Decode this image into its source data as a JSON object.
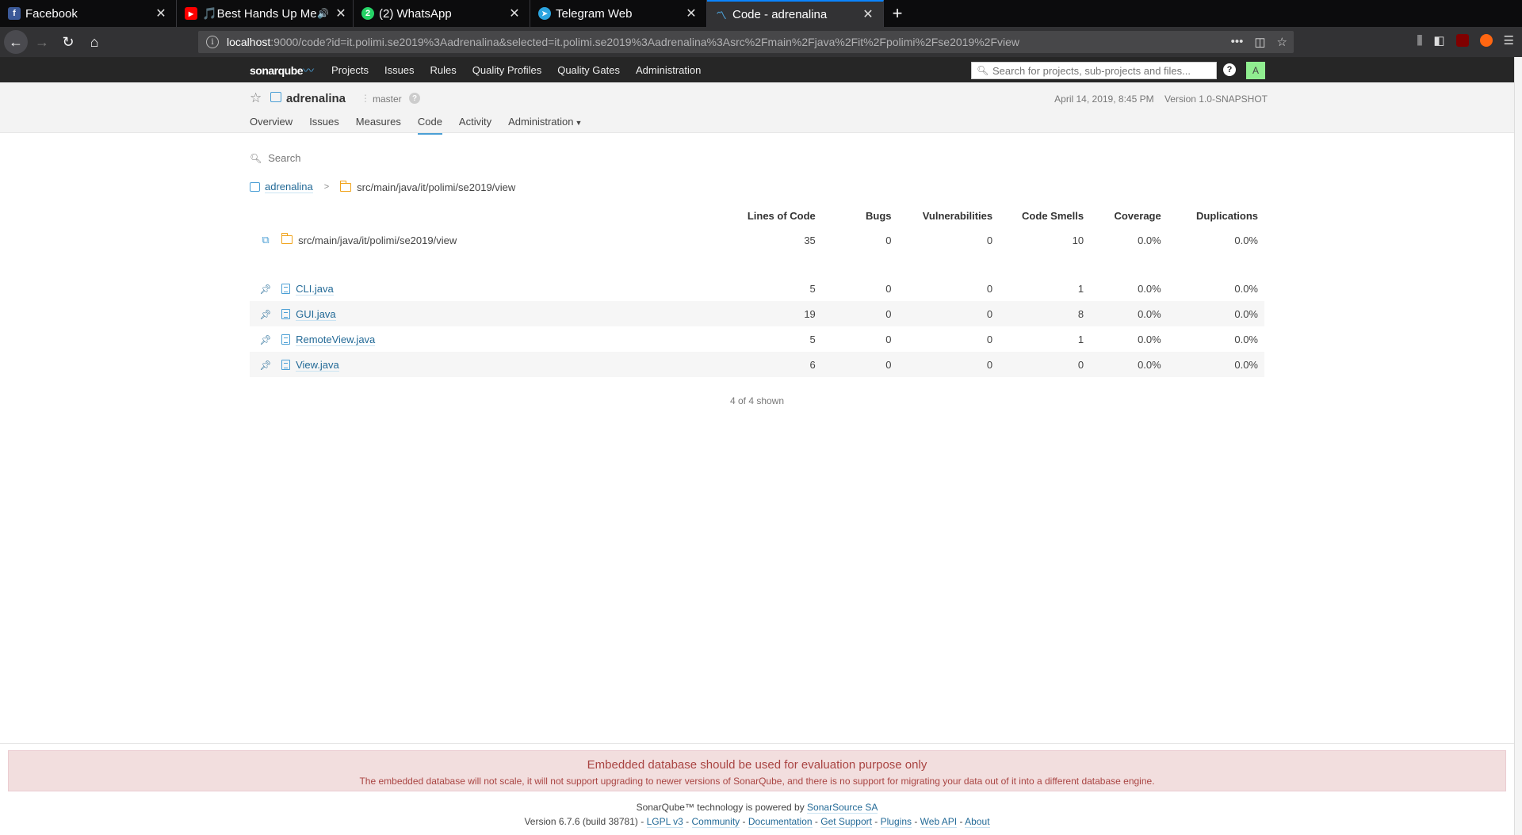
{
  "browser": {
    "tabs": [
      {
        "label": "Facebook",
        "favicon_color": "#3b5998",
        "favicon_glyph": "f"
      },
      {
        "label": "🎵Best Hands Up Meg",
        "favicon_color": "#ff0000",
        "favicon_glyph": "▶",
        "audio": "🔊"
      },
      {
        "label": "(2) WhatsApp",
        "favicon_color": "#25d366",
        "favicon_glyph": "2"
      },
      {
        "label": "Telegram Web",
        "favicon_color": "#2ca5e0",
        "favicon_glyph": "➤"
      },
      {
        "label": "Code - adrenalina",
        "favicon_color": "#4b9fd5",
        "favicon_glyph": "〽"
      }
    ],
    "url_host": "localhost",
    "url_rest": ":9000/code?id=it.polimi.se2019%3Aadrenalina&selected=it.polimi.se2019%3Aadrenalina%3Asrc%2Fmain%2Fjava%2Fit%2Fpolimi%2Fse2019%2Fview"
  },
  "sonar_nav": {
    "logo_text": "sonarqube",
    "links": [
      "Projects",
      "Issues",
      "Rules",
      "Quality Profiles",
      "Quality Gates",
      "Administration"
    ],
    "search_placeholder": "Search for projects, sub-projects and files...",
    "help_label": "?",
    "avatar_letter": "A"
  },
  "project": {
    "name": "adrenalina",
    "branch": "master",
    "analysis_date": "April 14, 2019, 8:45 PM",
    "version": "Version 1.0-SNAPSHOT",
    "tabs": [
      "Overview",
      "Issues",
      "Measures",
      "Code",
      "Activity",
      "Administration"
    ],
    "active_tab": "Code"
  },
  "code": {
    "search_placeholder": "Search",
    "breadcrumb": {
      "project": "adrenalina",
      "separator": ">",
      "folder": "src/main/java/it/polimi/se2019/view"
    },
    "columns": [
      "Lines of Code",
      "Bugs",
      "Vulnerabilities",
      "Code Smells",
      "Coverage",
      "Duplications"
    ],
    "base_row": {
      "name": "src/main/java/it/polimi/se2019/view",
      "loc": "35",
      "bugs": "0",
      "vulnerabilities": "0",
      "code_smells": "10",
      "coverage": "0.0%",
      "duplications": "0.0%"
    },
    "files": [
      {
        "name": "CLI.java",
        "loc": "5",
        "bugs": "0",
        "vulnerabilities": "0",
        "code_smells": "1",
        "coverage": "0.0%",
        "duplications": "0.0%"
      },
      {
        "name": "GUI.java",
        "loc": "19",
        "bugs": "0",
        "vulnerabilities": "0",
        "code_smells": "8",
        "coverage": "0.0%",
        "duplications": "0.0%"
      },
      {
        "name": "RemoteView.java",
        "loc": "5",
        "bugs": "0",
        "vulnerabilities": "0",
        "code_smells": "1",
        "coverage": "0.0%",
        "duplications": "0.0%"
      },
      {
        "name": "View.java",
        "loc": "6",
        "bugs": "0",
        "vulnerabilities": "0",
        "code_smells": "0",
        "coverage": "0.0%",
        "duplications": "0.0%"
      }
    ],
    "shown_text": "4 of 4 shown"
  },
  "alert": {
    "title": "Embedded database should be used for evaluation purpose only",
    "body": "The embedded database will not scale, it will not support upgrading to newer versions of SonarQube, and there is no support for migrating your data out of it into a different database engine."
  },
  "footer": {
    "powered_prefix": "SonarQube™ technology is powered by",
    "powered_link": "SonarSource SA",
    "version": "Version 6.7.6 (build 38781)",
    "links": [
      "LGPL v3",
      "Community",
      "Documentation",
      "Get Support",
      "Plugins",
      "Web API",
      "About"
    ]
  },
  "icons": {
    "back": "arrow-left",
    "forward": "arrow-right",
    "reload": "reload",
    "home": "home",
    "star": "star",
    "pin": "pin",
    "open": "external-link",
    "search": "search"
  }
}
